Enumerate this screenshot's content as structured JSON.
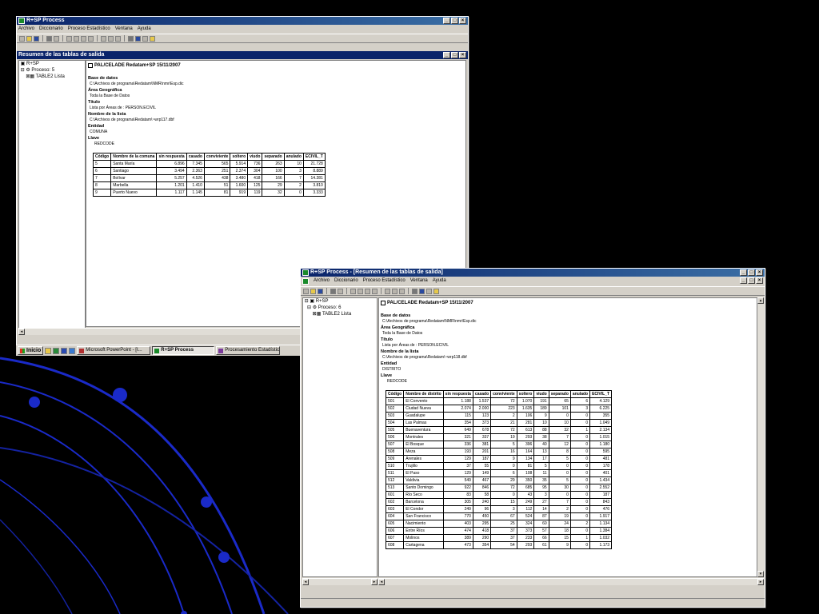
{
  "colors": {
    "title_bar": "#0a246a",
    "window_face": "#d4d0c8",
    "background": "#000000",
    "decor_blue": "#1a2ac8"
  },
  "icons": [
    "app-icon",
    "minimize-icon",
    "maximize-icon",
    "close-icon",
    "expand-icon",
    "process-icon",
    "table-icon",
    "report-icon",
    "play-icon",
    "help-icon"
  ],
  "win1": {
    "title": "R+SP Process",
    "menu": [
      "Archivo",
      "Diccionario",
      "Proceso Estadístico",
      "Ventana",
      "Ayuda"
    ],
    "child_title": "Resumen de las tablas de salida",
    "tree": {
      "root": "R+SP",
      "process": "Proceso: 5",
      "table": "TABLE2 Lista"
    },
    "report": {
      "title": "PAL/CELADE Redatam+SP 15/11/2007",
      "fields": [
        {
          "label": "Base de datos",
          "value": "C:\\Archivos de programa\\Redatam\\NMR\\nmr\\Esp.dic"
        },
        {
          "label": "Área Geográfica",
          "value": "Toda la Base de Datos"
        },
        {
          "label": "Título",
          "value": "Lista por Áreas de : PERSON.ECIVIL"
        },
        {
          "label": "Nombre de la lista",
          "value": "C:\\Archivos de programa\\Redatam\\~wrp117.dbf"
        },
        {
          "label": "Entidad",
          "value": "COMUNA"
        },
        {
          "label": "Llave",
          "value": "REDCODE"
        }
      ],
      "columns": [
        "Código",
        "Nombre de la comuna",
        "sin respuesta",
        "casado",
        "conviviente",
        "soltero",
        "viudo",
        "separado",
        "anulado",
        "ECIVIL_T"
      ],
      "rows": [
        [
          "5",
          "Santa María",
          "6.896",
          "7.345",
          "565",
          "5.914",
          "736",
          "263",
          "10",
          "21.728"
        ],
        [
          "6",
          "Santiago",
          "3.494",
          "2.363",
          "251",
          "2.374",
          "304",
          "100",
          "3",
          "8.889"
        ],
        [
          "7",
          "Bolívar",
          "5.257",
          "4.526",
          "438",
          "3.480",
          "418",
          "166",
          "7",
          "14.281"
        ],
        [
          "8",
          "Marbella",
          "1.201",
          "1.410",
          "51",
          "1.600",
          "125",
          "29",
          "2",
          "3.810"
        ],
        [
          "9",
          "Puerto Nuevo",
          "1.117",
          "1.145",
          "81",
          "919",
          "119",
          "32",
          "0",
          "3.333"
        ]
      ]
    }
  },
  "taskbar": {
    "start": "Inicio",
    "tasks": [
      "Microsoft PowerPoint - [I...",
      "R+SP Process",
      "Procesamiento Estadístic"
    ]
  },
  "win2": {
    "title": "R+SP Process - [Resumen de las tablas de salida]",
    "menu": [
      "Archivo",
      "Diccionario",
      "Proceso Estadístico",
      "Ventana",
      "Ayuda"
    ],
    "tree": {
      "root": "R+SP",
      "process": "Proceso: 6",
      "table": "TABLE2 Lista"
    },
    "report": {
      "title": "PAL/CELADE Redatam+SP 15/11/2007",
      "fields": [
        {
          "label": "Base de datos",
          "value": "C:\\Archivos de programa\\Redatam\\NMR\\nmr\\Esp.dic"
        },
        {
          "label": "Área Geográfica",
          "value": "Toda la Base de Datos"
        },
        {
          "label": "Título",
          "value": "Lista por Áreas de : PERSON.ECIVIL"
        },
        {
          "label": "Nombre de la lista",
          "value": "C:\\Archivos de programa\\Redatam\\~wrp118.dbf"
        },
        {
          "label": "Entidad",
          "value": "DISTRITO"
        },
        {
          "label": "Llave",
          "value": "REDCODE"
        }
      ],
      "columns": [
        "Código",
        "Nombre de distrito",
        "sin respuesta",
        "casado",
        "conviviente",
        "soltero",
        "viudo",
        "separado",
        "anulado",
        "ECIVIL_T"
      ],
      "rows": [
        [
          "501",
          "El Convento",
          "1.188",
          "1.537",
          "72",
          "1.070",
          "191",
          "65",
          "6",
          "4.129"
        ],
        [
          "502",
          "Ciudad Nueva",
          "2.074",
          "2.000",
          "223",
          "1.635",
          "189",
          "101",
          "3",
          "6.225"
        ],
        [
          "503",
          "Guadalupe",
          "115",
          "123",
          "2",
          "106",
          "9",
          "0",
          "0",
          "355"
        ],
        [
          "504",
          "Las Palmas",
          "354",
          "373",
          "21",
          "281",
          "10",
          "10",
          "0",
          "1.049"
        ],
        [
          "505",
          "Buenaventura",
          "649",
          "678",
          "72",
          "613",
          "88",
          "32",
          "1",
          "2.134"
        ],
        [
          "506",
          "Montrales",
          "321",
          "337",
          "19",
          "293",
          "38",
          "7",
          "0",
          "1.015"
        ],
        [
          "507",
          "El Bosque",
          "336",
          "381",
          "5",
          "396",
          "40",
          "12",
          "0",
          "1.180"
        ],
        [
          "508",
          "Meza",
          "193",
          "201",
          "16",
          "164",
          "13",
          "8",
          "0",
          "595"
        ],
        [
          "509",
          "Arenales",
          "129",
          "187",
          "9",
          "134",
          "17",
          "5",
          "0",
          "481"
        ],
        [
          "510",
          "Trujillo",
          "37",
          "55",
          "0",
          "81",
          "5",
          "0",
          "0",
          "178"
        ],
        [
          "511",
          "El Paso",
          "129",
          "149",
          "6",
          "108",
          "11",
          "0",
          "0",
          "401"
        ],
        [
          "512",
          "Valdivia",
          "549",
          "467",
          "29",
          "350",
          "35",
          "5",
          "0",
          "1.434"
        ],
        [
          "513",
          "Santo Domingo",
          "922",
          "846",
          "72",
          "685",
          "95",
          "30",
          "0",
          "2.552"
        ],
        [
          "601",
          "Río Seco",
          "83",
          "58",
          "0",
          "43",
          "3",
          "0",
          "0",
          "187"
        ],
        [
          "602",
          "Barcelona",
          "305",
          "240",
          "15",
          "249",
          "27",
          "7",
          "0",
          "843"
        ],
        [
          "603",
          "El Condor",
          "249",
          "96",
          "3",
          "112",
          "14",
          "2",
          "0",
          "476"
        ],
        [
          "604",
          "San Francisco",
          "770",
          "450",
          "67",
          "524",
          "87",
          "19",
          "0",
          "1.917"
        ],
        [
          "605",
          "Nacimiento",
          "403",
          "295",
          "25",
          "324",
          "60",
          "24",
          "2",
          "1.134"
        ],
        [
          "606",
          "Entre Ríos",
          "474",
          "418",
          "37",
          "373",
          "57",
          "18",
          "0",
          "1.384"
        ],
        [
          "607",
          "Molinos",
          "389",
          "290",
          "37",
          "233",
          "66",
          "15",
          "1",
          "1.032"
        ],
        [
          "608",
          "Cartagena",
          "473",
          "354",
          "54",
          "293",
          "61",
          "9",
          "0",
          "1.173"
        ]
      ]
    }
  }
}
